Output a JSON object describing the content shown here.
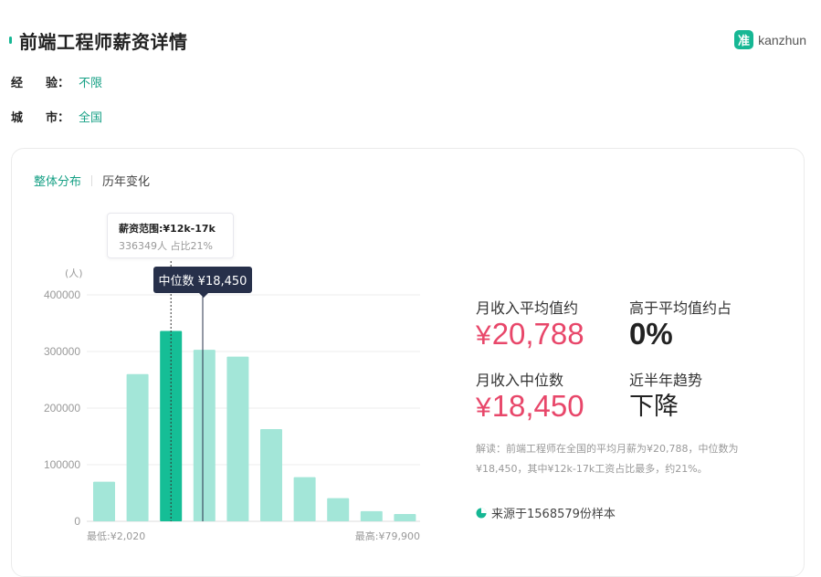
{
  "header": {
    "title": "前端工程师薪资详情",
    "logo_badge": "准",
    "logo_text": "kanzhun"
  },
  "filters": [
    {
      "label_a": "经",
      "label_b": "验：",
      "value": "不限"
    },
    {
      "label_a": "城",
      "label_b": "市：",
      "value": "全国"
    }
  ],
  "tabs": [
    {
      "label": "整体分布",
      "active": true
    },
    {
      "label": "历年变化",
      "active": false
    }
  ],
  "tooltip": {
    "title": "薪资范围:¥12k-17k",
    "sub": "336349人  占比21%"
  },
  "median_tag": "中位数 ¥18,450",
  "chart_data": {
    "type": "bar",
    "ylabel": "(人)",
    "ylim": [
      0,
      400000
    ],
    "yticks": [
      "0",
      "100000",
      "200000",
      "300000",
      "400000"
    ],
    "x_min_label": "最低:¥2,020",
    "x_max_label": "最高:¥79,900",
    "values": [
      70000,
      260000,
      336349,
      303000,
      291000,
      163000,
      78000,
      41000,
      18000,
      13000
    ],
    "highlight_index": 2,
    "colors": {
      "bar": "#a3e6d8",
      "highlight": "#15be96",
      "grid": "#eeeeee",
      "axis_text": "#999999"
    }
  },
  "stats": {
    "avg_label": "月收入平均值约",
    "avg_value": "20,788",
    "above_label": "高于平均值约占",
    "above_value": "0%",
    "median_label": "月收入中位数",
    "median_value": "18,450",
    "trend_label": "近半年趋势",
    "trend_value": "下降",
    "currency": "¥"
  },
  "note": {
    "line1": "解读：前端工程师在全国的平均月薪为¥20,788，中位数为",
    "line2": "¥18,450，其中¥12k-17k工资占比最多，约21%。"
  },
  "source": "来源于1568579份样本",
  "colors": {
    "accent": "#16b794",
    "red": "#e8476a",
    "dark_tag": "#27304a"
  }
}
